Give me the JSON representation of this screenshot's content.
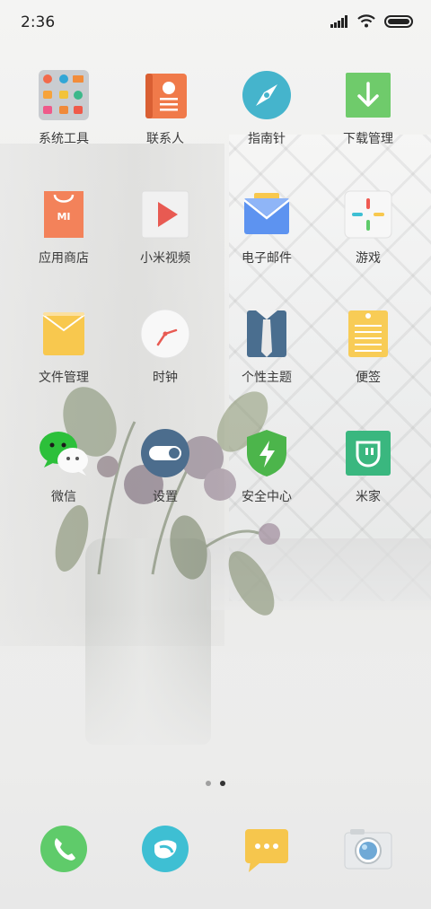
{
  "status": {
    "time": "2:36"
  },
  "apps": [
    [
      {
        "name": "app-system-tools",
        "icon": "tools-folder-icon",
        "label": "系统工具"
      },
      {
        "name": "app-contacts",
        "icon": "contacts-icon",
        "label": "联系人"
      },
      {
        "name": "app-compass",
        "icon": "compass-icon",
        "label": "指南针"
      },
      {
        "name": "app-downloads",
        "icon": "download-icon",
        "label": "下载管理"
      }
    ],
    [
      {
        "name": "app-mi-store",
        "icon": "shopping-bag-icon",
        "label": "应用商店"
      },
      {
        "name": "app-mi-video",
        "icon": "play-icon",
        "label": "小米视频"
      },
      {
        "name": "app-email",
        "icon": "mail-icon",
        "label": "电子邮件"
      },
      {
        "name": "app-games",
        "icon": "games-icon",
        "label": "游戏"
      }
    ],
    [
      {
        "name": "app-file-manager",
        "icon": "folder-icon",
        "label": "文件管理"
      },
      {
        "name": "app-clock",
        "icon": "clock-icon",
        "label": "时钟"
      },
      {
        "name": "app-themes",
        "icon": "tie-icon",
        "label": "个性主题"
      },
      {
        "name": "app-notes",
        "icon": "notes-icon",
        "label": "便签"
      }
    ],
    [
      {
        "name": "app-wechat",
        "icon": "wechat-icon",
        "label": "微信"
      },
      {
        "name": "app-settings",
        "icon": "toggle-icon",
        "label": "设置"
      },
      {
        "name": "app-security",
        "icon": "shield-icon",
        "label": "安全中心"
      },
      {
        "name": "app-mi-home",
        "icon": "mi-home-icon",
        "label": "米家"
      }
    ]
  ],
  "dock": [
    {
      "name": "dock-phone",
      "icon": "phone-icon"
    },
    {
      "name": "dock-browser",
      "icon": "browser-icon"
    },
    {
      "name": "dock-messages",
      "icon": "message-icon"
    },
    {
      "name": "dock-camera",
      "icon": "camera-icon"
    }
  ],
  "pager": {
    "pages": 2,
    "current": 2
  },
  "colors": {
    "contacts": "#f07a4a",
    "compass": "#45b4cc",
    "download": "#6fcb6b",
    "store": "#f3825a",
    "video_play": "#e85a52",
    "mail": "#5d93f0",
    "folder": "#f8c84e",
    "tie": "#4a6e8f",
    "notes": "#f8cc56",
    "wechat": "#2cc03a",
    "settings": "#4c6d8d",
    "security": "#4cb54b",
    "mihome": "#3ab77f",
    "phone": "#5fcb6a",
    "browser": "#3ebfd3",
    "message": "#f6c64d"
  }
}
